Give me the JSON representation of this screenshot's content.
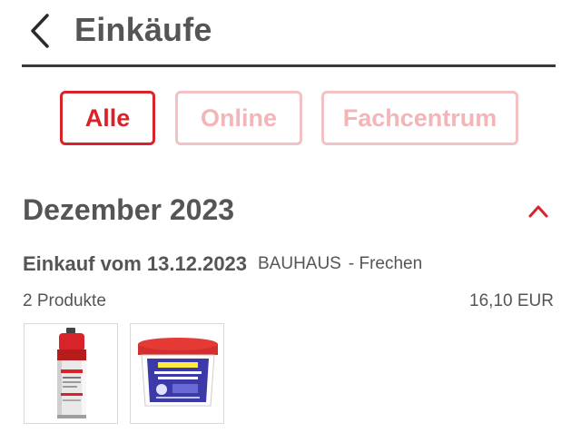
{
  "header": {
    "title": "Einkäufe",
    "back_icon": "chevron-left-icon"
  },
  "filters": {
    "all": "Alle",
    "online": "Online",
    "fachcentrum": "Fachcentrum",
    "selected": "Alle"
  },
  "colors": {
    "accent": "#d8232a",
    "accent_faded": "#f3c1c3",
    "text": "#555555",
    "divider": "#3a3a3a"
  },
  "month": {
    "title": "Dezember 2023",
    "toggle_icon": "chevron-up-icon"
  },
  "purchase": {
    "title": "Einkauf vom 13.12.2023",
    "store": "BAUHAUS",
    "location": "- Frechen",
    "product_count": "2 Produkte",
    "total": "16,10 EUR",
    "products": [
      {
        "icon": "spray-can-product-image"
      },
      {
        "icon": "paste-bucket-product-image"
      }
    ]
  }
}
